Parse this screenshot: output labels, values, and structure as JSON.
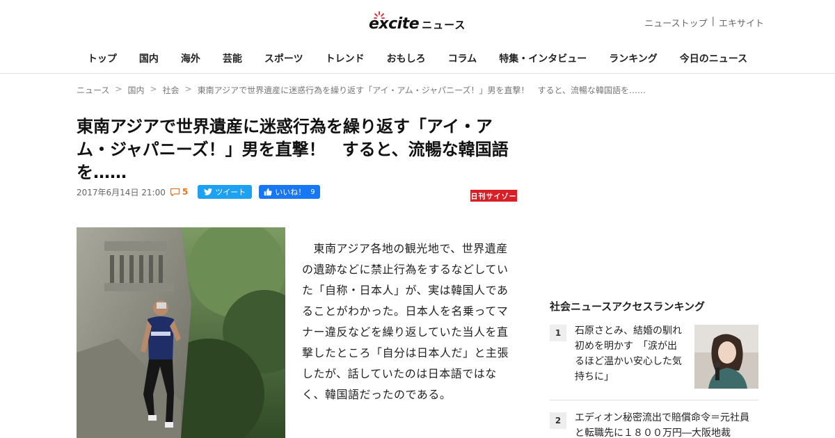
{
  "header": {
    "logo_text": "excite",
    "logo_suffix": "ニュース",
    "util_links": [
      "ニューストップ",
      "|",
      "エキサイト"
    ]
  },
  "nav": {
    "items": [
      "トップ",
      "国内",
      "海外",
      "芸能",
      "スポーツ",
      "トレンド",
      "おもしろ",
      "コラム",
      "特集・インタビュー",
      "ランキング",
      "今日のニュース"
    ]
  },
  "breadcrumb": {
    "items": [
      "ニュース",
      "国内",
      "社会",
      "東南アジアで世界遺産に迷惑行為を繰り返す「アイ・アム・ジャパニーズ！」男を直撃！　すると、流暢な韓国語を……"
    ],
    "separator": ">"
  },
  "article": {
    "title": "東南アジアで世界遺産に迷惑行為を繰り返す「アイ・アム・ジャパニーズ！」男を直撃！　すると、流暢な韓国語を……",
    "date": "2017年6月14日 21:00",
    "comment_count": "5",
    "tweet_label": "ツイート",
    "like_label": "いいね！",
    "like_count": "9",
    "source": "日刊サイゾー",
    "body": "　東南アジア各地の観光地で、世界遺産の遺跡などに禁止行為をするなどしていた「自称・日本人」が、実は韓国人であることがわかった。日本人を名乗ってマナー違反などを繰り返していた当人を直撃したところ「自分は日本人だ」と主張したが、話していたのは日本語ではなく、韓国語だったのである。"
  },
  "sidebar": {
    "ranking_heading": "社会ニュースアクセスランキング",
    "ranking": [
      {
        "rank": "1",
        "text": "石原さとみ、結婚の馴れ初めを明かす　「涙が出るほど温かい安心した気持ちに」"
      },
      {
        "rank": "2",
        "text": "エディオン秘密流出で賠償命令＝元社員と転職先に１８００万円―大阪地裁"
      }
    ]
  },
  "colors": {
    "accent_orange": "#e8751a",
    "twitter_blue": "#1da1f2",
    "facebook_blue": "#1877f2",
    "source_red": "#d91f26"
  }
}
